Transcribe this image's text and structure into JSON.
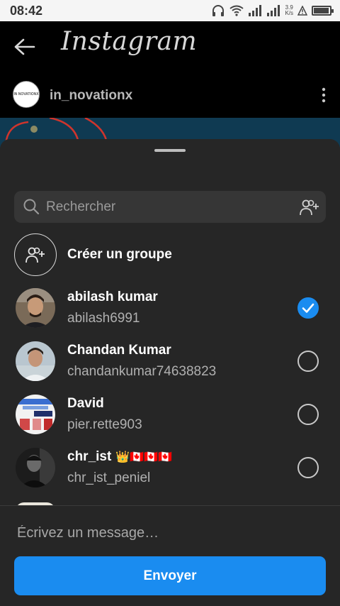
{
  "status_bar": {
    "time": "08:42",
    "net_speed_value": "3.9",
    "net_speed_unit": "K/s",
    "battery_level": 0.95
  },
  "app": {
    "brand": "Instagram",
    "post_username": "in_novationx",
    "post_avatar_text": "IN NOVATIONX"
  },
  "share_sheet": {
    "search_placeholder": "Rechercher",
    "create_group_label": "Créer un groupe",
    "contacts": [
      {
        "name": "abilash kumar",
        "username": "abilash6991",
        "selected": true,
        "flags": ""
      },
      {
        "name": "Chandan Kumar",
        "username": "chandankumar74638823",
        "selected": false,
        "flags": ""
      },
      {
        "name": "David",
        "username": "pier.rette903",
        "selected": false,
        "flags": ""
      },
      {
        "name": "chr_ist",
        "username": "chr_ist_peniel",
        "selected": false,
        "flags": "👑🇨🇦🇨🇦🇨🇦"
      }
    ],
    "message_placeholder": "Écrivez un message…",
    "send_label": "Envoyer"
  },
  "colors": {
    "accent": "#1a8cf0",
    "sheet_bg": "#262626",
    "search_bg": "#363636"
  }
}
